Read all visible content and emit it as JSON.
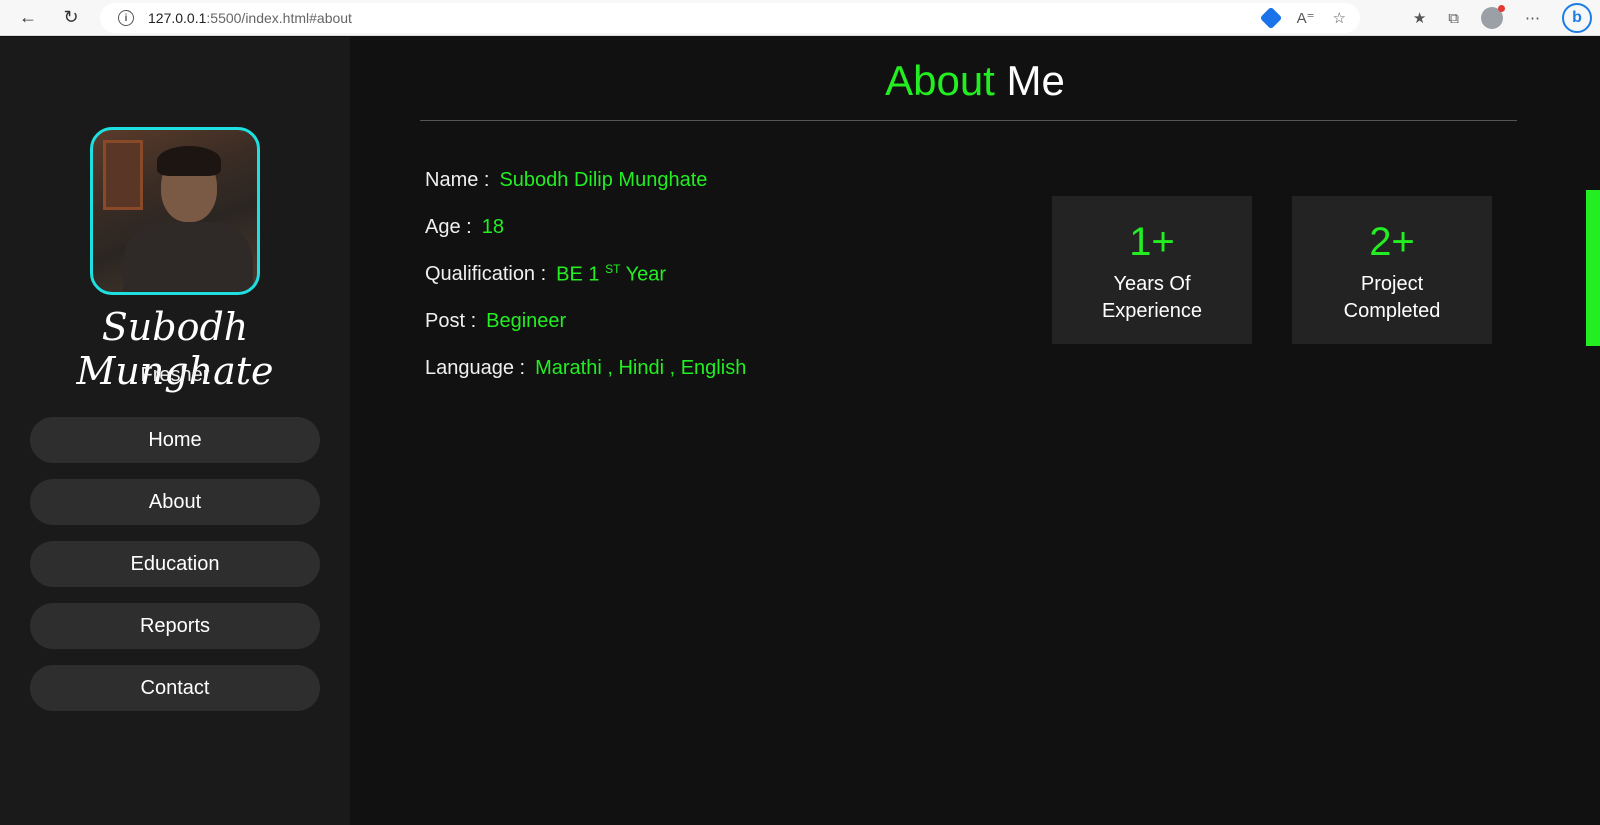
{
  "browser": {
    "url_host": "127.0.0.1",
    "url_rest": ":5500/index.html#about"
  },
  "sidebar": {
    "name": "Subodh Munghate",
    "role": "Fresher",
    "menu": [
      "Home",
      "About",
      "Education",
      "Reports",
      "Contact"
    ]
  },
  "main": {
    "title_accent": "About",
    "title_plain": "Me",
    "info": [
      {
        "label": "Name :",
        "value": "Subodh Dilip Munghate"
      },
      {
        "label": "Age :",
        "value": "18"
      },
      {
        "label": "Qualification :",
        "value_prefix": "BE 1",
        "value_sup": "ST",
        "value_suffix": "Year"
      },
      {
        "label": "Post :",
        "value": "Begineer"
      },
      {
        "label": "Language :",
        "value": "Marathi , Hindi , English"
      }
    ],
    "stats": [
      {
        "number": "1+",
        "label_line1": "Years Of",
        "label_line2": "Experience"
      },
      {
        "number": "2+",
        "label_line1": "Project",
        "label_line2": "Completed"
      }
    ]
  },
  "colors": {
    "accent": "#22ee22",
    "avatar_border": "#1fe0e0",
    "sidebar_bg": "#1a1a1a",
    "main_bg": "#111111"
  }
}
